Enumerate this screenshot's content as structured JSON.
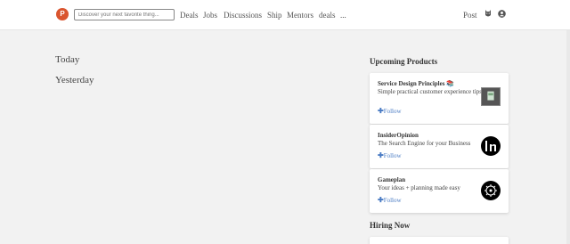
{
  "header": {
    "logo_letter": "P",
    "search_placeholder": "Discover your next favorite thing...",
    "nav": [
      "Deals",
      "Jobs",
      "Discussions",
      "Ship",
      "Mentors",
      "deals",
      "..."
    ],
    "post_label": "Post",
    "icons": [
      "cat-icon",
      "user-icon"
    ],
    "brand_color": "#da552f"
  },
  "feed": {
    "today_label": "Today",
    "yesterday_label": "Yesterday"
  },
  "sidebar": {
    "upcoming_title": "Upcoming Products",
    "products": [
      {
        "name": "Service Design Principles 📚",
        "tagline": "Simple practical customer experience tips",
        "follow_label": "Follow",
        "thumb_icon": "book-thumbnail"
      },
      {
        "name": "InsiderOpinion",
        "tagline": "The Search Engine for your Business",
        "follow_label": "Follow",
        "thumb_icon": "in-logo"
      },
      {
        "name": "Gameplan",
        "tagline": "Your ideas + planning made easy",
        "follow_label": "Follow",
        "thumb_icon": "gameplan-logo"
      }
    ],
    "hiring_title": "Hiring Now",
    "link_color": "#4b7cc4"
  }
}
